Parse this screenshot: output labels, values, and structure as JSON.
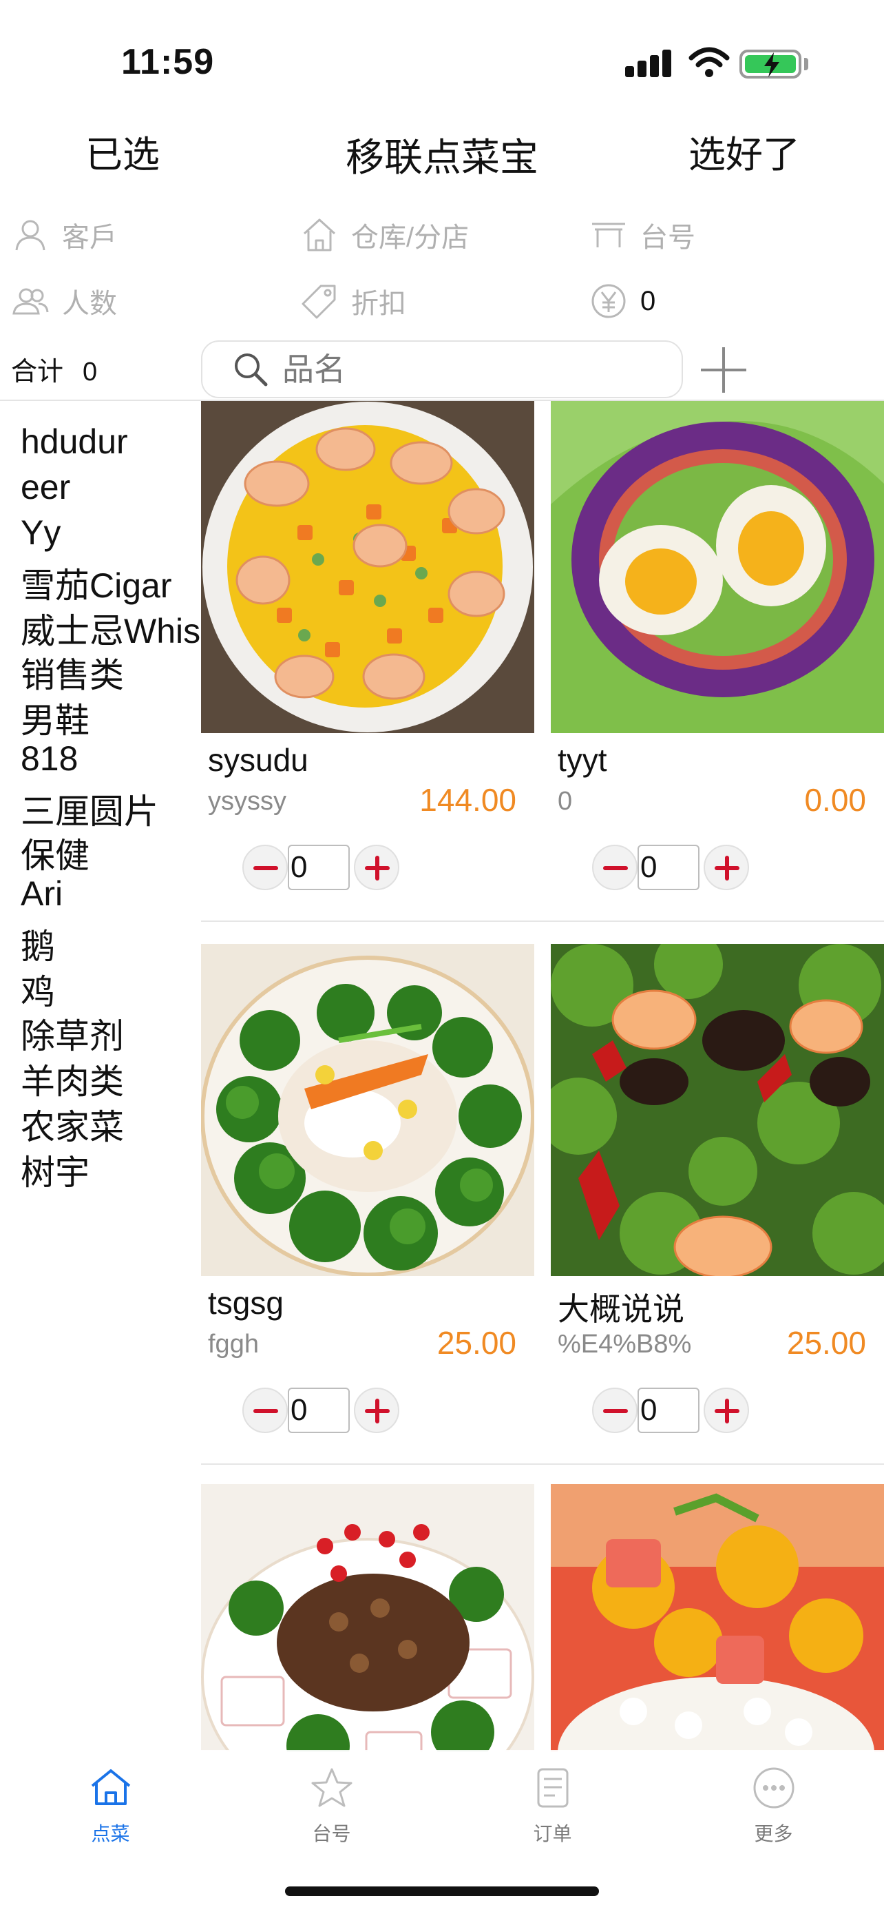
{
  "status": {
    "time": "11:59"
  },
  "nav": {
    "left": "已选",
    "title": "移联点菜宝",
    "right": "选好了"
  },
  "info": {
    "customer": "客戶",
    "store": "仓库/分店",
    "table": "台号",
    "people": "人数",
    "discount": "折扣",
    "amount": "0"
  },
  "totals": {
    "label": "合计",
    "value": "0"
  },
  "search": {
    "placeholder": "品名"
  },
  "categories": [
    "hdudur",
    "eer",
    "Yy",
    "雪茄Cigar",
    "威士忌Whisky",
    "销售类",
    "男鞋",
    "818",
    "三厘圆片",
    "保健",
    "Ari",
    "鹅",
    "鸡",
    "除草剂",
    "羊肉类",
    "农家菜",
    "树宇"
  ],
  "products": [
    {
      "name": "sysudu",
      "sub": "ysyssy",
      "price": "144.00",
      "qty": "0"
    },
    {
      "name": "tyyt",
      "sub": "0",
      "price": "0.00",
      "qty": "0"
    },
    {
      "name": "tsgsg",
      "sub": "fggh",
      "price": "25.00",
      "qty": "0"
    },
    {
      "name": "大概说说",
      "sub": "%E4%B8%",
      "price": "25.00",
      "qty": "0"
    }
  ],
  "tabs": [
    {
      "label": "点菜",
      "icon": "home-icon"
    },
    {
      "label": "台号",
      "icon": "star-icon"
    },
    {
      "label": "订单",
      "icon": "order-icon"
    },
    {
      "label": "更多",
      "icon": "more-icon"
    }
  ],
  "colors": {
    "accent": "#1a73e8",
    "price": "#f08a23",
    "stepper": "#d0112b"
  }
}
